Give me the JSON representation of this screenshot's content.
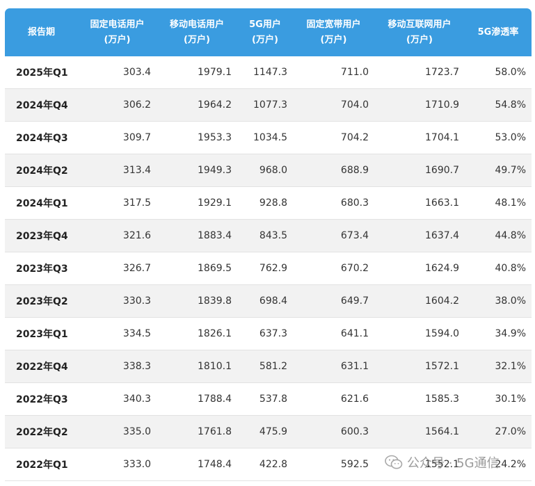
{
  "table": {
    "headers": [
      [
        "报告期"
      ],
      [
        "固定电话用户",
        "(万户)"
      ],
      [
        "移动电话用户",
        "(万户)"
      ],
      [
        "5G用户",
        "(万户)"
      ],
      [
        "固定宽带用户",
        "(万户)"
      ],
      [
        "移动互联网用户",
        "(万户)"
      ],
      [
        "5G渗透率"
      ]
    ],
    "rows": [
      [
        "2025年Q1",
        "303.4",
        "1979.1",
        "1147.3",
        "711.0",
        "1723.7",
        "58.0%"
      ],
      [
        "2024年Q4",
        "306.2",
        "1964.2",
        "1077.3",
        "704.0",
        "1710.9",
        "54.8%"
      ],
      [
        "2024年Q3",
        "309.7",
        "1953.3",
        "1034.5",
        "704.2",
        "1704.1",
        "53.0%"
      ],
      [
        "2024年Q2",
        "313.4",
        "1949.3",
        "968.0",
        "688.9",
        "1690.7",
        "49.7%"
      ],
      [
        "2024年Q1",
        "317.5",
        "1929.1",
        "928.8",
        "680.3",
        "1663.1",
        "48.1%"
      ],
      [
        "2023年Q4",
        "321.6",
        "1883.4",
        "843.5",
        "673.4",
        "1637.4",
        "44.8%"
      ],
      [
        "2023年Q3",
        "326.7",
        "1869.5",
        "762.9",
        "670.2",
        "1624.9",
        "40.8%"
      ],
      [
        "2023年Q2",
        "330.3",
        "1839.8",
        "698.4",
        "649.7",
        "1604.2",
        "38.0%"
      ],
      [
        "2023年Q1",
        "334.5",
        "1826.1",
        "637.3",
        "641.1",
        "1594.0",
        "34.9%"
      ],
      [
        "2022年Q4",
        "338.3",
        "1810.1",
        "581.2",
        "631.1",
        "1572.1",
        "32.1%"
      ],
      [
        "2022年Q3",
        "340.3",
        "1788.4",
        "537.8",
        "621.6",
        "1585.3",
        "30.1%"
      ],
      [
        "2022年Q2",
        "335.0",
        "1761.8",
        "475.9",
        "600.3",
        "1564.1",
        "27.0%"
      ],
      [
        "2022年Q1",
        "333.0",
        "1748.4",
        "422.8",
        "592.5",
        "1552.1",
        "24.2%"
      ]
    ]
  },
  "watermark": {
    "text": "公众号 · 5G通信",
    "icon": "wechat-icon"
  },
  "colors": {
    "header_bg": "#3a9ce0",
    "header_text": "#ffffff",
    "row_alt_bg": "#f2f2f2",
    "text": "#333333"
  }
}
